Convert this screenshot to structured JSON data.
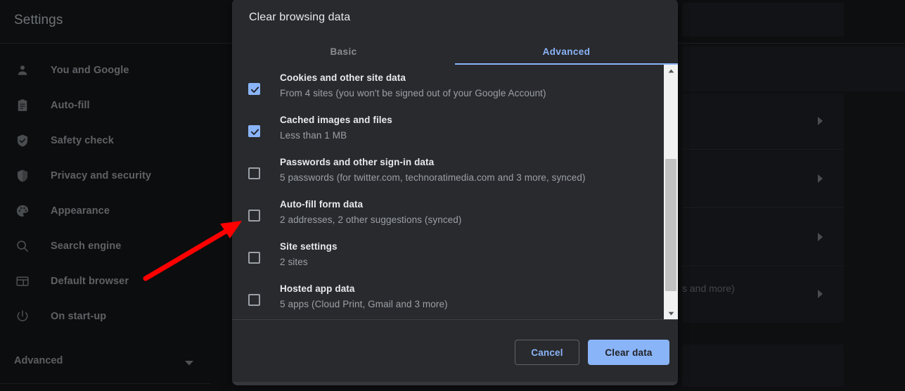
{
  "app": {
    "title": "Settings",
    "accent_blue": "#8ab4f8",
    "dialog_bg": "#292a2d",
    "page_bg": "#0e0f11",
    "annotation_color": "#ff0000"
  },
  "sidebar": {
    "items": [
      {
        "label": "You and Google",
        "icon": "person-icon"
      },
      {
        "label": "Auto-fill",
        "icon": "clipboard-icon"
      },
      {
        "label": "Safety check",
        "icon": "shield-check-icon"
      },
      {
        "label": "Privacy and security",
        "icon": "shield-icon"
      },
      {
        "label": "Appearance",
        "icon": "palette-icon"
      },
      {
        "label": "Search engine",
        "icon": "search-icon"
      },
      {
        "label": "Default browser",
        "icon": "browser-window-icon"
      },
      {
        "label": "On start-up",
        "icon": "power-icon"
      }
    ],
    "advanced": {
      "label": "Advanced",
      "icon": "chevron-down-icon"
    }
  },
  "background": {
    "visible_text_fragment": "s and more)"
  },
  "dialog": {
    "title": "Clear browsing data",
    "tabs": [
      {
        "label": "Basic",
        "active": false
      },
      {
        "label": "Advanced",
        "active": true
      }
    ],
    "items": [
      {
        "title": "Cookies and other site data",
        "subtitle": "From 4 sites (you won't be signed out of your Google Account)",
        "checked": true
      },
      {
        "title": "Cached images and files",
        "subtitle": "Less than 1 MB",
        "checked": true
      },
      {
        "title": "Passwords and other sign-in data",
        "subtitle": "5 passwords (for twitter.com, technoratimedia.com and 3 more, synced)",
        "checked": false
      },
      {
        "title": "Auto-fill form data",
        "subtitle": "2 addresses, 2 other suggestions (synced)",
        "checked": false
      },
      {
        "title": "Site settings",
        "subtitle": "2 sites",
        "checked": false
      },
      {
        "title": "Hosted app data",
        "subtitle": "5 apps (Cloud Print, Gmail and 3 more)",
        "checked": false
      }
    ],
    "buttons": {
      "cancel": "Cancel",
      "confirm": "Clear data"
    },
    "scrollbar": {
      "up_icon": "scroll-up-arrow-icon",
      "down_icon": "scroll-down-arrow-icon"
    }
  }
}
